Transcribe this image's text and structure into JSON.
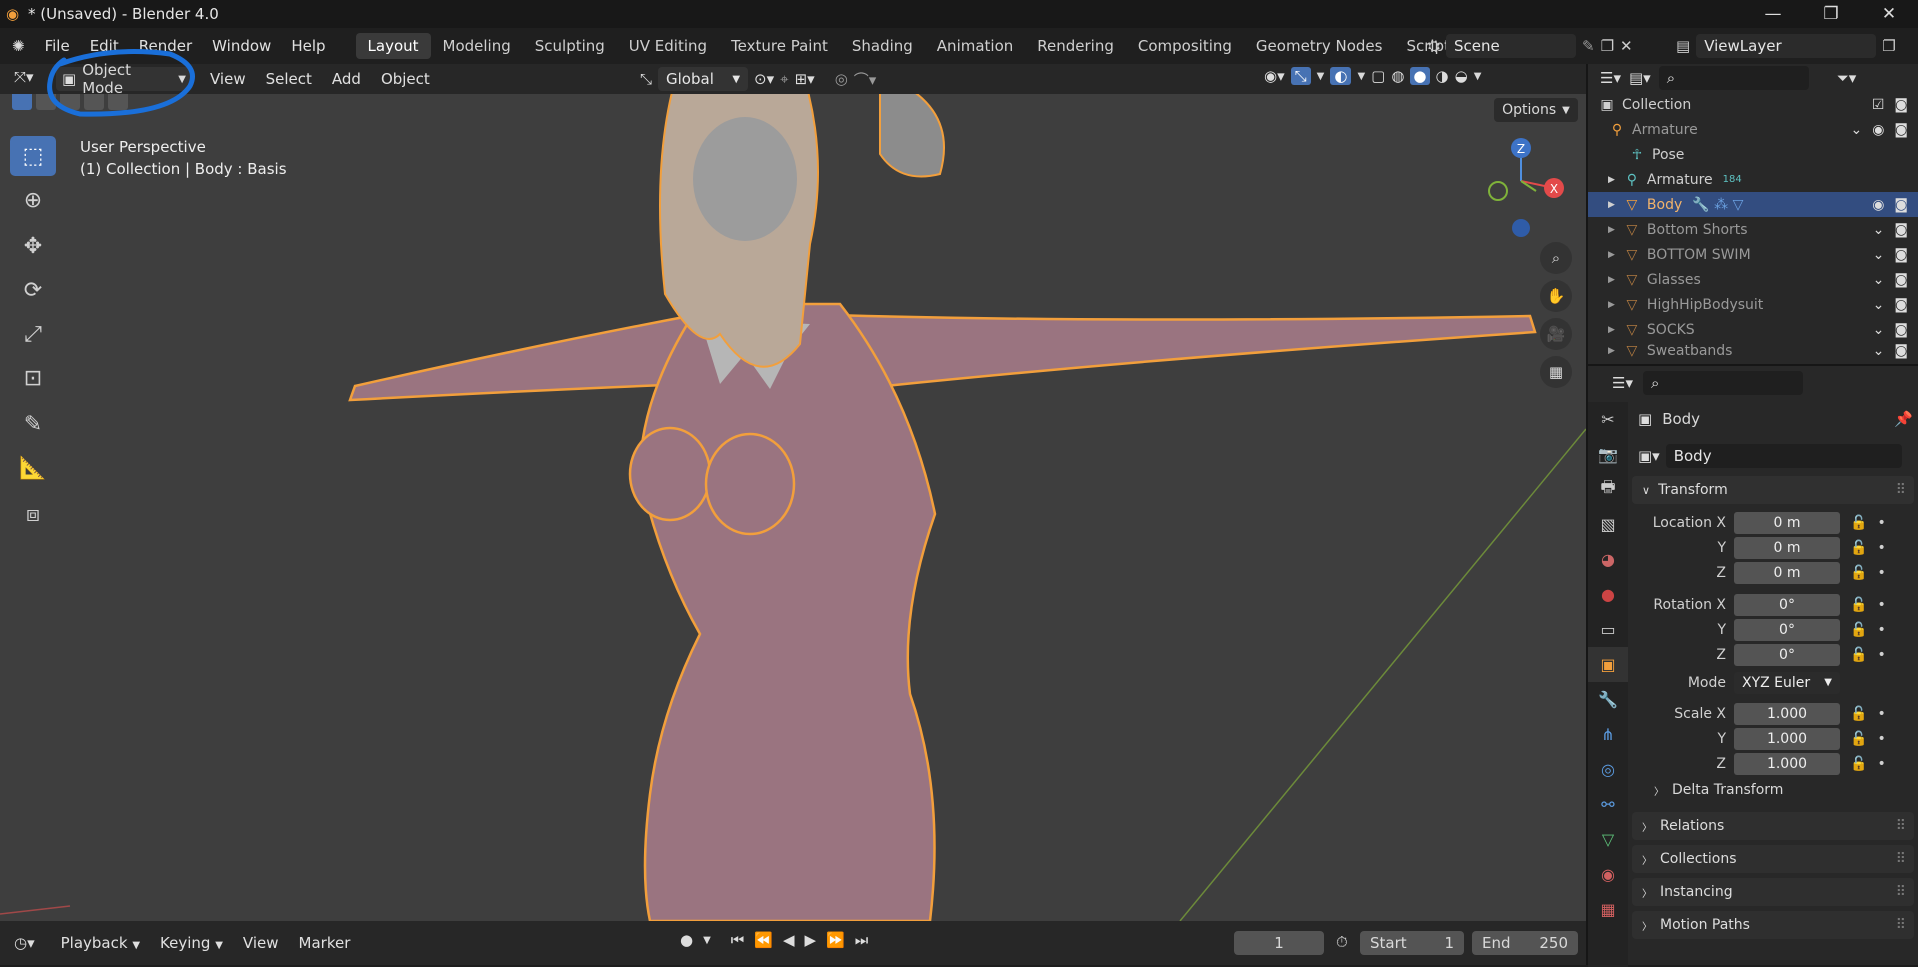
{
  "window": {
    "title": "* (Unsaved) - Blender 4.0"
  },
  "menu": [
    "File",
    "Edit",
    "Render",
    "Window",
    "Help"
  ],
  "workspaces": [
    "Layout",
    "Modeling",
    "Sculpting",
    "UV Editing",
    "Texture Paint",
    "Shading",
    "Animation",
    "Rendering",
    "Compositing",
    "Geometry Nodes",
    "Scripting"
  ],
  "active_workspace": "Layout",
  "scene": {
    "name": "Scene",
    "view_layer": "ViewLayer"
  },
  "viewport_header": {
    "mode": "Object Mode",
    "menus": [
      "View",
      "Select",
      "Add",
      "Object"
    ],
    "orientation": "Global",
    "options_label": "Options"
  },
  "viewport_info": {
    "line1": "User Perspective",
    "line2": "(1) Collection | Body : Basis"
  },
  "gizmo": {
    "x": "X",
    "z": "Z"
  },
  "outliner": {
    "root": "Collection",
    "items": [
      {
        "name": "Armature",
        "icon": "armature-icon",
        "badge": ""
      },
      {
        "name": "Pose",
        "icon": "pose-icon",
        "badge": ""
      },
      {
        "name": "Armature",
        "icon": "armature-data-icon",
        "badge": "184"
      },
      {
        "name": "Body",
        "icon": "mesh-icon",
        "badge": ""
      },
      {
        "name": "Bottom Shorts",
        "icon": "mesh-icon",
        "badge": ""
      },
      {
        "name": "BOTTOM SWIM",
        "icon": "mesh-icon",
        "badge": ""
      },
      {
        "name": "Glasses",
        "icon": "mesh-icon",
        "badge": ""
      },
      {
        "name": "HighHipBodysuit",
        "icon": "mesh-icon",
        "badge": ""
      },
      {
        "name": "SOCKS",
        "icon": "mesh-icon",
        "badge": ""
      },
      {
        "name": "Sweatbands",
        "icon": "mesh-icon",
        "badge": ""
      }
    ],
    "selected": "Body"
  },
  "properties": {
    "object_name": "Body",
    "data_name": "Body",
    "transform_label": "Transform",
    "location": {
      "label": "Location X",
      "x": "0 m",
      "y": "0 m",
      "z": "0 m"
    },
    "rotation": {
      "label": "Rotation X",
      "x": "0°",
      "y": "0°",
      "z": "0°"
    },
    "mode_label": "Mode",
    "mode_value": "XYZ Euler",
    "scale": {
      "label": "Scale X",
      "x": "1.000",
      "y": "1.000",
      "z": "1.000"
    },
    "axis_y": "Y",
    "axis_z": "Z",
    "panels": [
      "Delta Transform",
      "Relations",
      "Collections",
      "Instancing",
      "Motion Paths"
    ]
  },
  "timeline": {
    "menus": [
      "Playback",
      "Keying",
      "View",
      "Marker"
    ],
    "current_frame": "1",
    "start_label": "Start",
    "start": "1",
    "end_label": "End",
    "end": "250"
  },
  "colors": {
    "accent": "#4772b3",
    "selection_outline": "#f29f3c",
    "annotation": "#1a6fd9",
    "mesh": "#9a7480"
  }
}
